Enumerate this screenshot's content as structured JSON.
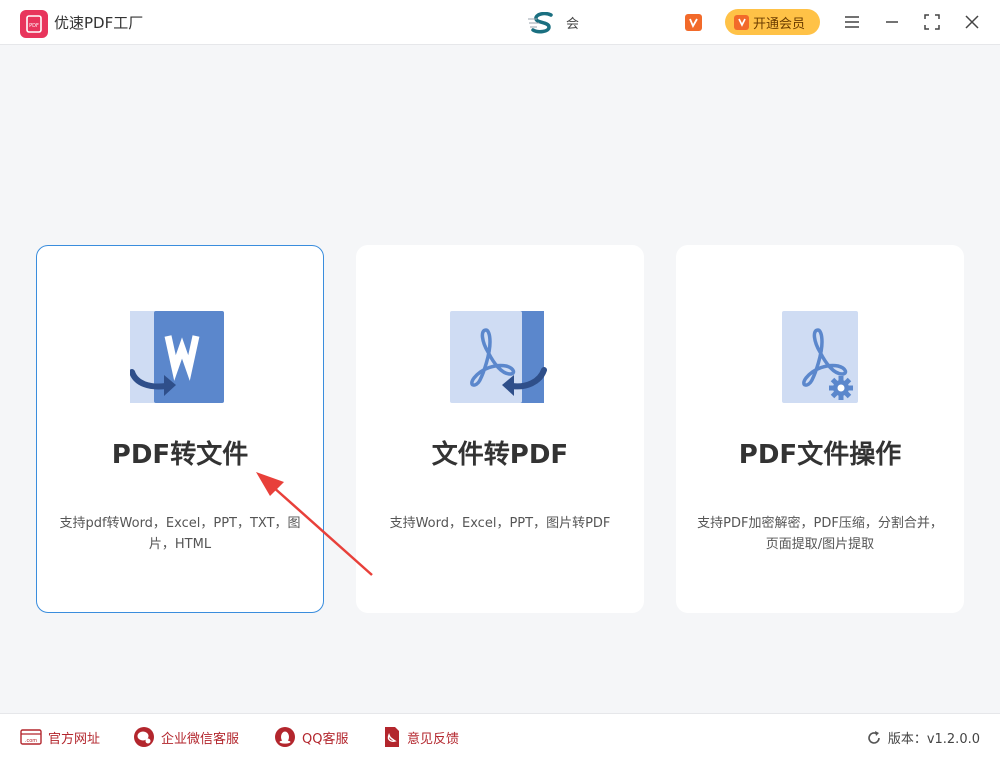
{
  "titlebar": {
    "app_title": "优速PDF工厂",
    "logo_text": "PDF",
    "user_name": "会",
    "vip_button_label": "开通会员"
  },
  "cards": [
    {
      "title": "PDF转文件",
      "description": "支持pdf转Word，Excel，PPT，TXT，图片，HTML",
      "icon": "pdf-to-word-icon",
      "selected": true
    },
    {
      "title": "文件转PDF",
      "description": "支持Word，Excel，PPT，图片转PDF",
      "icon": "file-to-pdf-icon",
      "selected": false
    },
    {
      "title": "PDF文件操作",
      "description": "支持PDF加密解密，PDF压缩，分割合并，页面提取/图片提取",
      "icon": "pdf-operations-icon",
      "selected": false
    }
  ],
  "footer": {
    "links": [
      {
        "label": "官方网址",
        "icon": "website-icon"
      },
      {
        "label": "企业微信客服",
        "icon": "wechat-work-icon"
      },
      {
        "label": "QQ客服",
        "icon": "qq-icon"
      },
      {
        "label": "意见反馈",
        "icon": "feedback-icon"
      }
    ],
    "version_label": "版本：v1.2.0.0"
  },
  "colors": {
    "accent_blue": "#3a8ddd",
    "icon_blue": "#5b87cc",
    "icon_light": "#cfdcf3",
    "brand_pink": "#e8355c",
    "vip_gold": "#ffc247",
    "footer_red": "#b3262d",
    "annotation_red": "#e8403a"
  }
}
